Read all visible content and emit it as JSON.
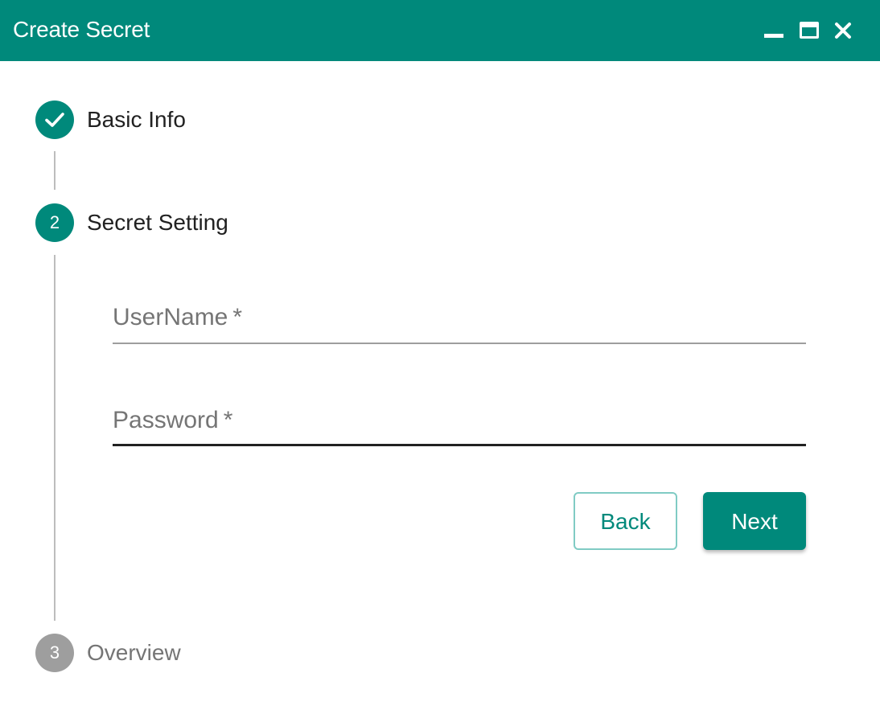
{
  "window": {
    "title": "Create Secret",
    "controls": [
      "minimize-icon",
      "maximize-icon",
      "close-icon"
    ],
    "accent_color": "#00897b"
  },
  "stepper": {
    "steps": [
      {
        "number": "1",
        "label": "Basic Info",
        "status": "completed",
        "icon": "checkmark-icon"
      },
      {
        "number": "2",
        "label": "Secret Setting",
        "status": "active"
      },
      {
        "number": "3",
        "label": "Overview",
        "status": "pending"
      }
    ]
  },
  "form": {
    "username": {
      "label": "UserName",
      "required_marker": "*",
      "value": ""
    },
    "password": {
      "label": "Password",
      "required_marker": "*",
      "value": ""
    }
  },
  "actions": {
    "back_label": "Back",
    "next_label": "Next"
  }
}
